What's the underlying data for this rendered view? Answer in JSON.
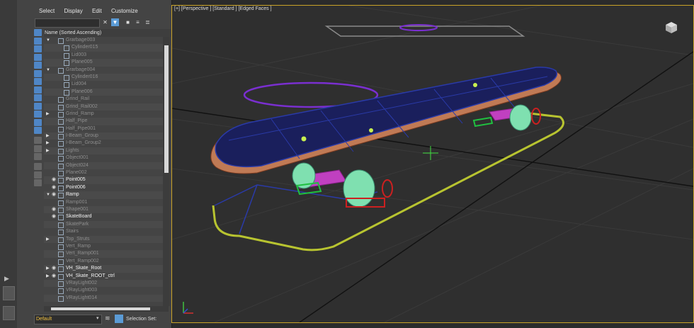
{
  "menu": [
    "Select",
    "Display",
    "Edit",
    "Customize"
  ],
  "list_header": "Name (Sorted Ascending)",
  "rows": [
    {
      "name": "Grarbage003",
      "indent": 1,
      "eye": false,
      "tri": "open",
      "state": "dim"
    },
    {
      "name": "Cylinder015",
      "indent": 2,
      "eye": false,
      "tri": "",
      "state": "dim"
    },
    {
      "name": "Lid003",
      "indent": 2,
      "eye": false,
      "tri": "",
      "state": "dim"
    },
    {
      "name": "Plane005",
      "indent": 2,
      "eye": false,
      "tri": "",
      "state": "dim"
    },
    {
      "name": "Grarbage004",
      "indent": 1,
      "eye": false,
      "tri": "open",
      "state": "dim"
    },
    {
      "name": "Cylinder016",
      "indent": 2,
      "eye": false,
      "tri": "",
      "state": "dim"
    },
    {
      "name": "Lid004",
      "indent": 2,
      "eye": false,
      "tri": "",
      "state": "dim"
    },
    {
      "name": "Plane006",
      "indent": 2,
      "eye": false,
      "tri": "",
      "state": "dim"
    },
    {
      "name": "Grind_Rail",
      "indent": 1,
      "eye": false,
      "tri": "",
      "state": "dim"
    },
    {
      "name": "Grind_Rail002",
      "indent": 1,
      "eye": false,
      "tri": "",
      "state": "dim"
    },
    {
      "name": "Grind_Ramp",
      "indent": 1,
      "eye": false,
      "tri": "closed",
      "state": "dim"
    },
    {
      "name": "Half_Pipe",
      "indent": 1,
      "eye": false,
      "tri": "",
      "state": "dim"
    },
    {
      "name": "Half_Pipe001",
      "indent": 1,
      "eye": false,
      "tri": "",
      "state": "dim"
    },
    {
      "name": "I-Beam_Group",
      "indent": 1,
      "eye": false,
      "tri": "closed",
      "state": "dim"
    },
    {
      "name": "I-Beam_Group2",
      "indent": 1,
      "eye": false,
      "tri": "closed",
      "state": "dim"
    },
    {
      "name": "Lights",
      "indent": 1,
      "eye": false,
      "tri": "closed",
      "state": "dim"
    },
    {
      "name": "Object001",
      "indent": 1,
      "eye": false,
      "tri": "",
      "state": "dim"
    },
    {
      "name": "Object024",
      "indent": 1,
      "eye": false,
      "tri": "",
      "state": "dim"
    },
    {
      "name": "Plane002",
      "indent": 1,
      "eye": false,
      "tri": "",
      "state": "dim"
    },
    {
      "name": "Point005",
      "indent": 1,
      "eye": true,
      "tri": "",
      "state": "bright"
    },
    {
      "name": "Point006",
      "indent": 1,
      "eye": true,
      "tri": "",
      "state": "bright"
    },
    {
      "name": "Ramp",
      "indent": 1,
      "eye": true,
      "tri": "open",
      "state": "bright"
    },
    {
      "name": "Ramp001",
      "indent": 1,
      "eye": false,
      "tri": "",
      "state": "dim"
    },
    {
      "name": "Shape001",
      "indent": 1,
      "eye": true,
      "tri": "",
      "state": "dim"
    },
    {
      "name": "SkateBoard",
      "indent": 1,
      "eye": true,
      "tri": "",
      "state": "bright"
    },
    {
      "name": "SkatePark",
      "indent": 1,
      "eye": false,
      "tri": "",
      "state": "dim"
    },
    {
      "name": "Stairs",
      "indent": 1,
      "eye": false,
      "tri": "",
      "state": "dim"
    },
    {
      "name": "Top_Struts",
      "indent": 1,
      "eye": false,
      "tri": "closed",
      "state": "dim"
    },
    {
      "name": "Vert_Ramp",
      "indent": 1,
      "eye": false,
      "tri": "",
      "state": "dim"
    },
    {
      "name": "Vert_Ramp001",
      "indent": 1,
      "eye": false,
      "tri": "",
      "state": "dim"
    },
    {
      "name": "Vert_Ramp002",
      "indent": 1,
      "eye": false,
      "tri": "",
      "state": "dim"
    },
    {
      "name": "VH_Skate_Root",
      "indent": 1,
      "eye": true,
      "tri": "closed",
      "state": "bright"
    },
    {
      "name": "VH_Skate_ROOT_ctrl",
      "indent": 1,
      "eye": true,
      "tri": "closed",
      "state": "bright"
    },
    {
      "name": "VRayLight002",
      "indent": 1,
      "eye": false,
      "tri": "",
      "state": "dim"
    },
    {
      "name": "VRayLight003",
      "indent": 1,
      "eye": false,
      "tri": "",
      "state": "dim"
    },
    {
      "name": "VRayLight014",
      "indent": 1,
      "eye": false,
      "tri": "",
      "state": "dim"
    }
  ],
  "layer": "Default",
  "selection_set_label": "Selection Set:",
  "viewport": {
    "label": "[+] [Perspective ] [Standard ] [Edged Faces ]",
    "border_color": "#c9a227"
  },
  "icons": {
    "clear": "close-icon",
    "filter": "filter-icon",
    "lock": "lock-icon",
    "hierarchy": "hierarchy-icon"
  },
  "colors": {
    "deck_top": "#1a1f5c",
    "deck_edge": "#c07a55",
    "wheels": "#7fe0b0",
    "trucks": "#c040c0",
    "ring_purple": "#7a2fd0",
    "spline_yellow": "#b8c430",
    "spline_blue": "#2a3aa8",
    "handle_red": "#cc2020"
  }
}
